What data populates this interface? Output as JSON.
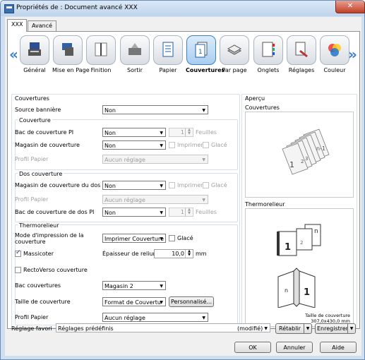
{
  "window": {
    "title": "Propriétés de : Document avancé XXX",
    "close_glyph": "✕"
  },
  "tabs": [
    {
      "label": "XXX"
    },
    {
      "label": "Avancé"
    }
  ],
  "nav": {
    "prev": "«",
    "next": "»"
  },
  "icons": [
    {
      "label": "Général",
      "icon": "general-icon"
    },
    {
      "label": "Mise en Page",
      "icon": "layout-icon"
    },
    {
      "label": "Finition",
      "icon": "finishing-icon"
    },
    {
      "label": "Sortir",
      "icon": "output-icon"
    },
    {
      "label": "Papier",
      "icon": "paper-icon"
    },
    {
      "label": "Couvertures",
      "icon": "cover-icon",
      "selected": true
    },
    {
      "label": "Par page",
      "icon": "per-page-icon"
    },
    {
      "label": "Onglets",
      "icon": "tabs-icon"
    },
    {
      "label": "Réglages",
      "icon": "settings-icon"
    },
    {
      "label": "Couleur",
      "icon": "color-icon"
    }
  ],
  "covers": {
    "section_title": "Couvertures",
    "banner_label": "Source bannière",
    "banner_value": "Non",
    "front": {
      "title": "Couverture",
      "pi_tray_label": "Bac de couverture PI",
      "pi_tray_value": "Non",
      "pi_sheets_value": "1",
      "pi_sheets_unit": "Feuilles",
      "mag_label": "Magasin de couverture",
      "mag_value": "Non",
      "print_label": "Imprimer",
      "glossy_label": "Glacé",
      "profile_label": "Profil Papier",
      "profile_value": "Aucun réglage"
    },
    "back": {
      "title": "Dos couverture",
      "mag_label": "Magasin de couverture du dos",
      "mag_value": "Non",
      "print_label": "Imprimer",
      "glossy_label": "Glacé",
      "profile_label": "Profil Papier",
      "profile_value": "Aucun réglage",
      "pi_tray_label": "Bac de couverture de dos PI",
      "pi_tray_value": "Non",
      "pi_sheets_value": "1",
      "pi_sheets_unit": "Feuilles"
    },
    "thermo": {
      "title": "Thermorelieur",
      "mode_label": "Mode d'impression de la couverture",
      "mode_value": "Imprimer Couverture",
      "glossy_label": "Glacé",
      "trim_label": "Massicoter",
      "thickness_label": "Épaisseur de reliure",
      "thickness_value": "10,0",
      "thickness_unit": "mm",
      "duplex_label": "RectoVerso couverture",
      "tray_label": "Bac couvertures",
      "tray_value": "Magasin 2",
      "size_label": "Taille de couverture",
      "size_value": "Format de Couvertu",
      "custom_btn": "Personnalisé...",
      "profile_label": "Profil Papier",
      "profile_value": "Aucun réglage"
    }
  },
  "preview": {
    "title": "Aperçu",
    "covers_label": "Couvertures",
    "thermo_label": "Thermorelieur",
    "size_caption_1": "Taille de couverture",
    "size_caption_2": "307,0x430,0 mm"
  },
  "footer": {
    "fav_label": "Réglage favori",
    "fav_value": "Réglages prédéfinis",
    "modified": "(modifié)",
    "restore_btn": "Rétablir",
    "save_btn": "Enregistrer",
    "ok": "OK",
    "cancel": "Annuler",
    "help": "Aide"
  }
}
